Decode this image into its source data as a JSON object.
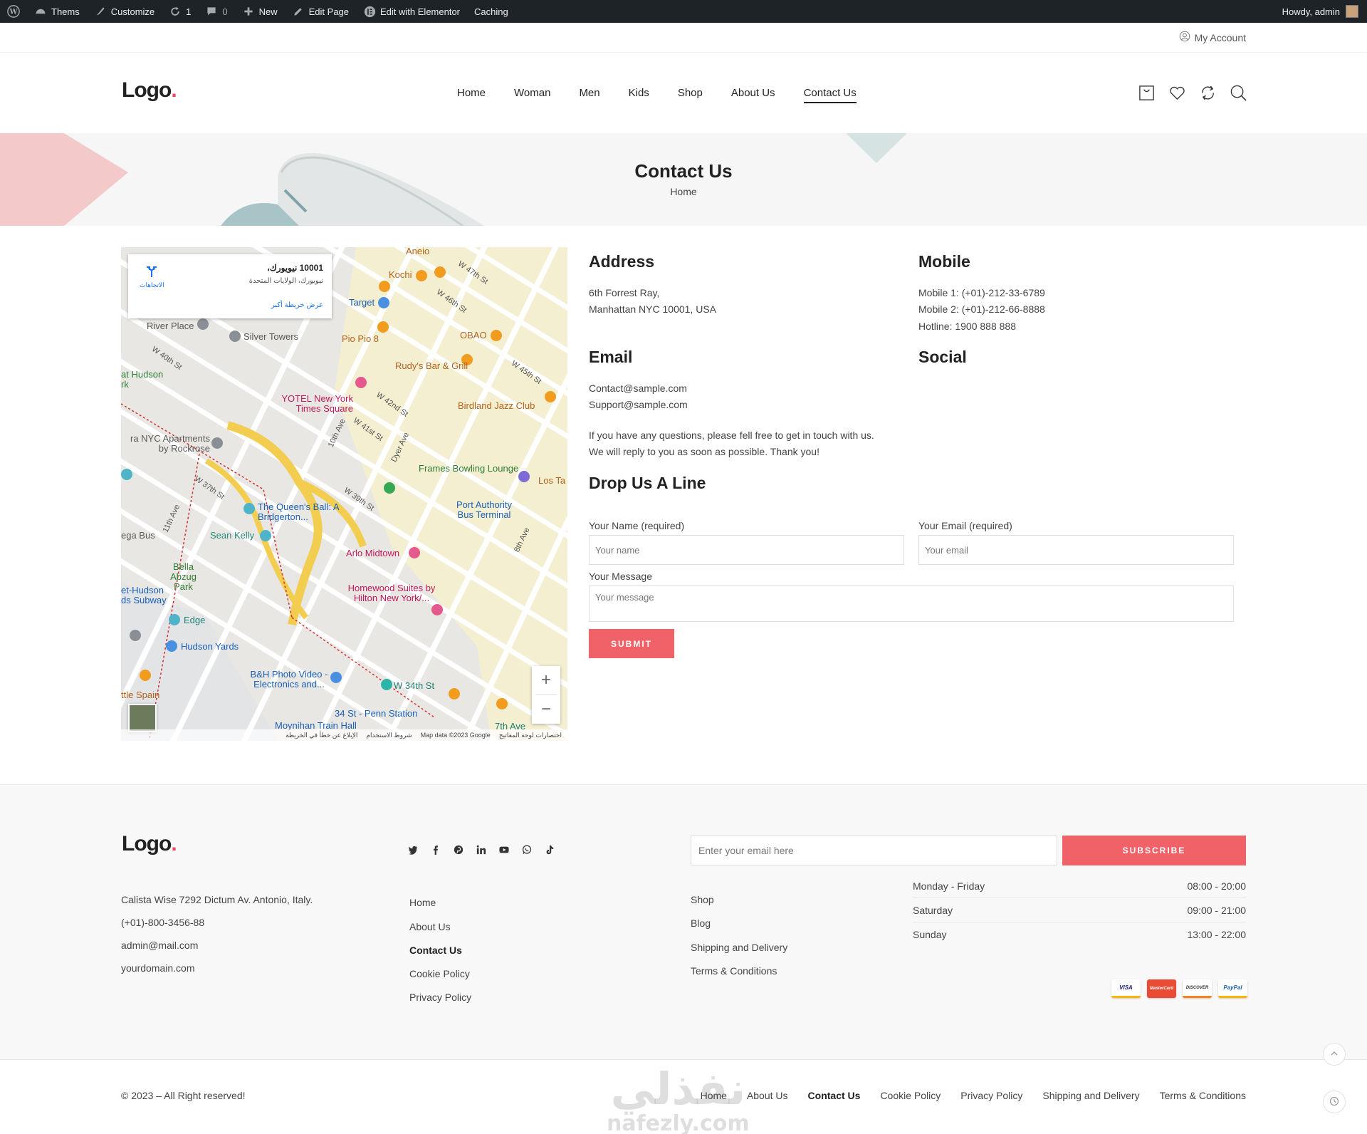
{
  "adminbar": {
    "items": [
      "Thems",
      "Customize",
      "1",
      "0",
      "New",
      "Edit Page",
      "Edit with Elementor",
      "Caching"
    ],
    "howdy": "Howdy, admin"
  },
  "topbar": {
    "my_account": "My Account"
  },
  "header": {
    "logo": "Logo",
    "logo_dot": ".",
    "nav": [
      "Home",
      "Woman",
      "Men",
      "Kids",
      "Shop",
      "About Us",
      "Contact Us"
    ],
    "active_nav": "Contact Us"
  },
  "page_title": {
    "title": "Contact Us",
    "breadcrumb": "Home"
  },
  "map": {
    "infobox": {
      "zip": "10001 نيويورك،",
      "subtitle": "نيويورك، الولايات المتحدة",
      "larger_map": "عرض خريطة أكبر",
      "directions": "الاتجاهات"
    },
    "labels": [
      "River Place",
      "Silver Towers",
      "Kochi",
      "Target",
      "Pio Pio 8",
      "OBAO",
      "Rudy's Bar & Grill",
      "YOTEL New York Times Square",
      "Birdland Jazz Club",
      "W 42nd St",
      "W 41st St",
      "10th Ave",
      "Dyer Ave",
      "ra NYC Apartments by Rockrose",
      "Frames Bowling Lounge",
      "Los Ta",
      "The Queen's Ball: A Bridgerton...",
      "Port Authority Bus Terminal",
      "Sean Kelly",
      "Arlo Midtown",
      "Bella Abzug Park",
      "Homewood Suites by Hilton New York/...",
      "et-Hudson ds Subway",
      "Edge",
      "Hudson Yards",
      "B&H Photo Video - Electronics and...",
      "W 34th St",
      "34 St - Penn Station",
      "Moynihan Train Hall",
      "7th Ave",
      "ttle Spain",
      "W 40th St",
      "at Hudson rk",
      "ega Bus",
      "11th Ave",
      "W 37th St",
      "W 39th St",
      "8th Ave",
      "Aneio",
      "W 47th St",
      "W 46th St",
      "W 45th St"
    ],
    "attribution": [
      "اختصارات لوحة المفاتيح",
      "Map data ©2023 Google",
      "شروط الاستخدام",
      "الإبلاغ عن خطأ في الخريطة"
    ],
    "zoom_in": "+",
    "zoom_out": "−"
  },
  "contact": {
    "address_title": "Address",
    "address_lines": [
      "6th Forrest Ray,",
      "Manhattan NYC 10001, USA"
    ],
    "mobile_title": "Mobile",
    "mobile_lines": [
      "Mobile 1: (+01)-212-33-6789",
      "Mobile 2: (+01)-212-66-8888",
      "Hotline: 1900 888 888"
    ],
    "email_title": "Email",
    "email_lines": [
      "Contact@sample.com",
      "Support@sample.com"
    ],
    "social_title": "Social",
    "note_lines": [
      "If you have any questions, please fell free to get in touch with us.",
      "We will reply to you as soon as possible. Thank you!"
    ],
    "form_title": "Drop Us A Line"
  },
  "form": {
    "name_label": "Your Name (required)",
    "name_placeholder": "Your name",
    "email_label": "Your Email (required)",
    "email_placeholder": "Your email",
    "message_label": "Your Message",
    "message_placeholder": "Your message",
    "submit": "SUBMIT"
  },
  "footer": {
    "logo": "Logo",
    "logo_dot": ".",
    "social_icons": [
      "twitter-icon",
      "facebook-icon",
      "pinterest-icon",
      "linkedin-icon",
      "youtube-icon",
      "whatsapp-icon",
      "tiktok-icon"
    ],
    "newsletter_placeholder": "Enter your email here",
    "subscribe": "SUBSCRIBE",
    "contact_lines": [
      "Calista Wise 7292 Dictum Av. Antonio, Italy.",
      "(+01)-800-3456-88",
      "admin@mail.com",
      "yourdomain.com"
    ],
    "links1": [
      "Home",
      "About Us",
      "Contact Us",
      "Cookie Policy",
      "Privacy Policy"
    ],
    "links2": [
      "Shop",
      "Blog",
      "Shipping and Delivery",
      "Terms & Conditions"
    ],
    "hours": [
      {
        "day": "Monday - Friday",
        "time": "08:00 - 20:00"
      },
      {
        "day": "Saturday",
        "time": "09:00 - 21:00"
      },
      {
        "day": "Sunday",
        "time": "13:00 - 22:00"
      }
    ],
    "payments": [
      "VISA",
      "MasterCard",
      "DISCOVER",
      "PayPal"
    ]
  },
  "bottom": {
    "copyright": "© 2023 – All Right reserved!",
    "links": [
      "Home",
      "About Us",
      "Contact Us",
      "Cookie Policy",
      "Privacy Policy",
      "Shipping and Delivery",
      "Terms & Conditions"
    ],
    "watermark_ar": "نفذلي",
    "watermark_en": "nafezly.com"
  },
  "colors": {
    "accent": "#f16268",
    "adminbar": "#1d2327",
    "band": "#f6f6f7",
    "footer_bg": "#f8f8f8"
  }
}
